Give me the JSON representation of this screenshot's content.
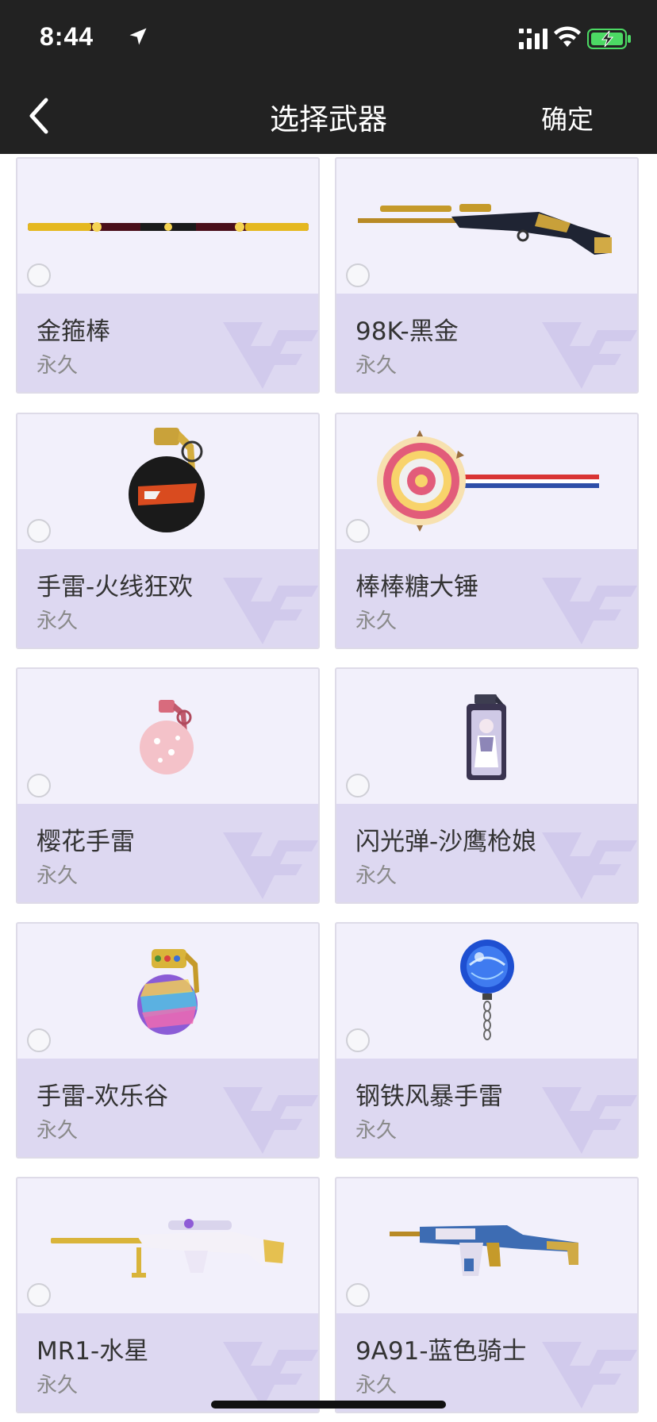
{
  "status_bar": {
    "time": "8:44"
  },
  "nav": {
    "title": "选择武器",
    "confirm_label": "确定"
  },
  "colors": {
    "header_bg": "#222222",
    "card_bg": "#f2f0fb",
    "info_bg": "#ddd8f1",
    "watermark": "#c9bfe9",
    "battery_green": "#4cd964"
  },
  "items": [
    {
      "name": "金箍棒",
      "duration": "永久",
      "icon": "golden-staff-icon"
    },
    {
      "name": "98K-黑金",
      "duration": "永久",
      "icon": "sniper-rifle-icon"
    },
    {
      "name": "手雷-火线狂欢",
      "duration": "永久",
      "icon": "grenade-icon"
    },
    {
      "name": "棒棒糖大锤",
      "duration": "永久",
      "icon": "lollipop-hammer-icon"
    },
    {
      "name": "樱花手雷",
      "duration": "永久",
      "icon": "pink-grenade-icon"
    },
    {
      "name": "闪光弹-沙鹰枪娘",
      "duration": "永久",
      "icon": "flashbang-icon"
    },
    {
      "name": "手雷-欢乐谷",
      "duration": "永久",
      "icon": "rainbow-grenade-icon"
    },
    {
      "name": "钢铁风暴手雷",
      "duration": "永久",
      "icon": "blue-orb-grenade-icon"
    },
    {
      "name": "MR1-水星",
      "duration": "永久",
      "icon": "white-sniper-icon"
    },
    {
      "name": "9A91-蓝色骑士",
      "duration": "永久",
      "icon": "blue-smg-icon"
    }
  ]
}
